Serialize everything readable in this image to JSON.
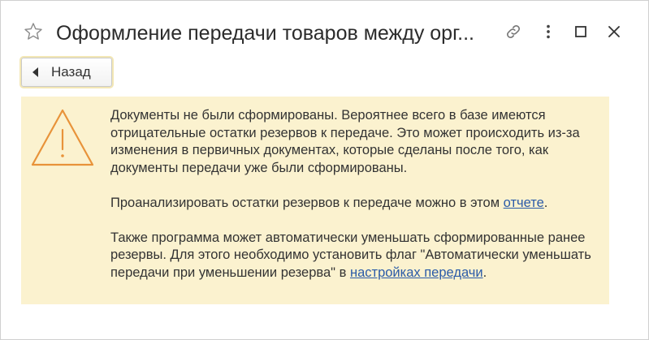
{
  "window": {
    "title": "Оформление передачи товаров между орг..."
  },
  "toolbar": {
    "back_label": "Назад"
  },
  "alert": {
    "paragraph1": "Документы не были сформированы. Вероятнее всего в базе имеются отрицательные остатки резервов к передаче. Это может происходить из-за изменения в первичных документах, которые сделаны после того, как документы передачи уже были сформированы.",
    "paragraph2_text": "Проанализировать остатки резервов к передаче можно в этом ",
    "paragraph2_link": "отчете",
    "paragraph2_end": ".",
    "paragraph3_text": "Также программа может автоматически уменьшать сформированные ранее резервы. Для этого необходимо установить флаг \"Автоматически уменьшать передачи при уменьшении резерва\" в ",
    "paragraph3_link": "настройках передачи",
    "paragraph3_end": "."
  },
  "icons": {
    "favorite": "star-icon",
    "link": "link-icon",
    "more": "more-vertical-icon",
    "maximize": "maximize-icon",
    "close": "close-icon",
    "back": "back-arrow-icon",
    "warning": "warning-icon"
  },
  "colors": {
    "alert_background": "#fbf2cf",
    "warning_icon": "#e8933a",
    "link": "#2a5ba8",
    "back_button_focus": "#f3e7b5"
  }
}
